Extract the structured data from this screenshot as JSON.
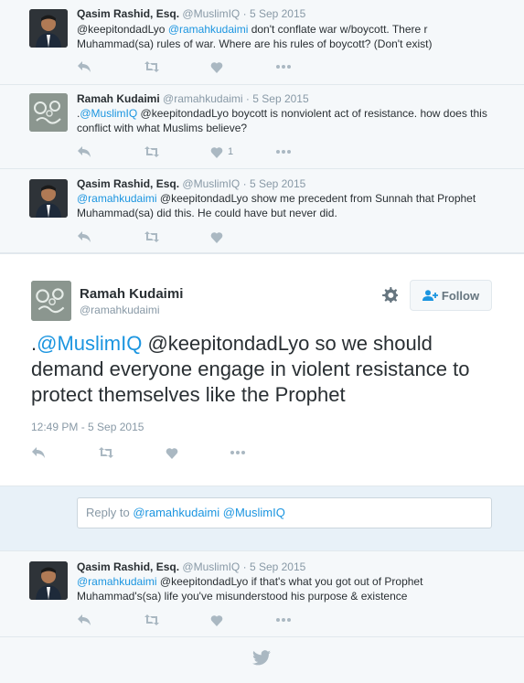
{
  "tweets_above": [
    {
      "name": "Qasim Rashid, Esq.",
      "handle": "@MuslimIQ",
      "date": "5 Sep 2015",
      "parts": [
        {
          "t": "@keepitondadLyo "
        },
        {
          "t": "@ramahkudaimi",
          "m": true
        },
        {
          "t": " don't conflate war w/boycott. There r Muhammad(sa) rules of war. Where are his rules of boycott? (Don't exist)"
        }
      ]
    },
    {
      "name": "Ramah Kudaimi",
      "handle": "@ramahkudaimi",
      "date": "5 Sep 2015",
      "like_count": "1",
      "parts": [
        {
          "t": "."
        },
        {
          "t": "@MuslimIQ",
          "m": true
        },
        {
          "t": " @keepitondadLyo boycott is nonviolent act of resistance. how does this conflict with what Muslims believe?"
        }
      ]
    },
    {
      "name": "Qasim Rashid, Esq.",
      "handle": "@MuslimIQ",
      "date": "5 Sep 2015",
      "parts": [
        {
          "t": "@ramahkudaimi",
          "m": true
        },
        {
          "t": " @keepitondadLyo show me precedent from Sunnah that Prophet Muhammad(sa) did this. He could have but never did."
        }
      ]
    }
  ],
  "main_tweet": {
    "name": "Ramah Kudaimi",
    "handle": "@ramahkudaimi",
    "follow_label": "Follow",
    "parts": [
      {
        "t": "."
      },
      {
        "t": "@MuslimIQ",
        "m": true
      },
      {
        "t": " @keepitondadLyo so we should demand everyone engage in violent resistance to protect themselves like the Prophet"
      }
    ],
    "timestamp": "12:49 PM - 5 Sep 2015"
  },
  "reply_box": {
    "prefix": "Reply to ",
    "mentions": "@ramahkudaimi @MuslimIQ"
  },
  "tweets_below": [
    {
      "name": "Qasim Rashid, Esq.",
      "handle": "@MuslimIQ",
      "date": "5 Sep 2015",
      "parts": [
        {
          "t": "@ramahkudaimi",
          "m": true
        },
        {
          "t": " @keepitondadLyo if that's what you got out of Prophet Muhammad's(sa) life you've misunderstood his purpose & existence"
        }
      ]
    }
  ],
  "icons": {
    "reply": "reply-icon",
    "retweet": "retweet-icon",
    "like": "heart-icon",
    "more": "more-icon",
    "gear": "gear-icon",
    "follow": "add-user-icon",
    "footer": "twitter-bird-icon"
  },
  "colors": {
    "link": "#1b95e0",
    "muted": "#8899a6",
    "text": "#292f33",
    "icon": "#aab8c2",
    "reply_bar": "#e8f1f8"
  }
}
